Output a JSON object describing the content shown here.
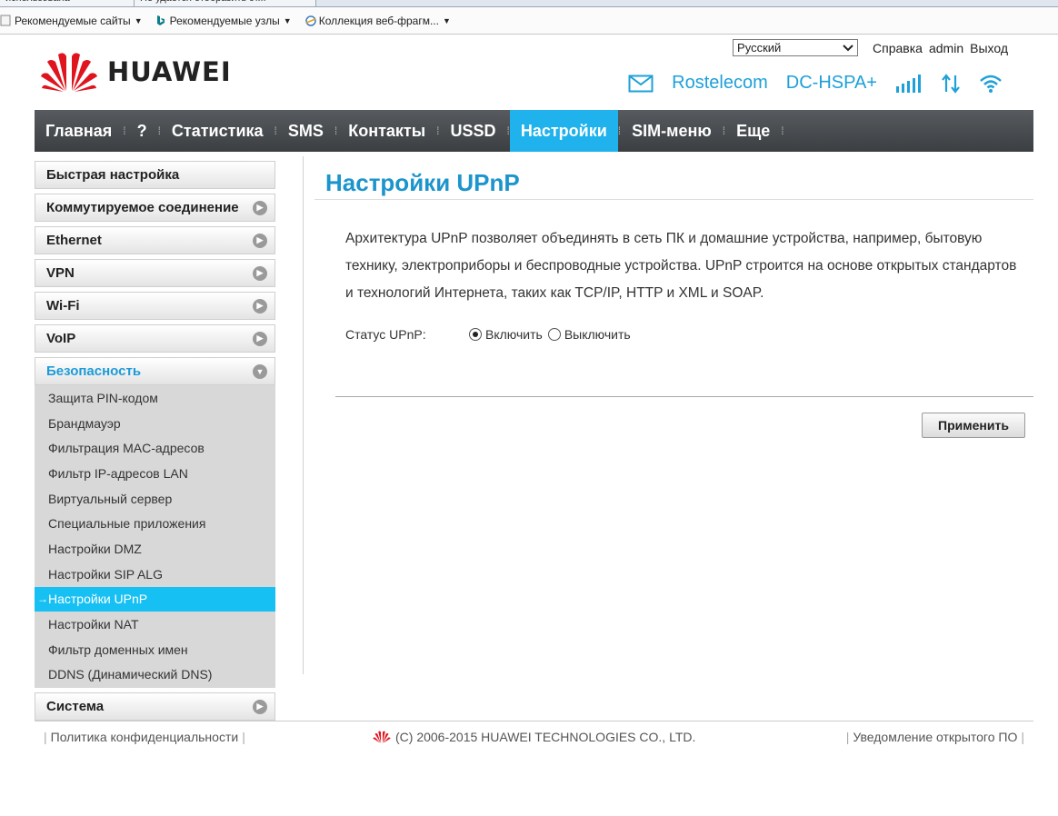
{
  "browser": {
    "tabs": [
      "использована",
      "Не удается отобразить эт..."
    ],
    "favorites": [
      {
        "label": "Рекомендуемые сайты",
        "icon": "recommended-sites-icon"
      },
      {
        "label": "Рекомендуемые узлы",
        "icon": "bing-icon"
      },
      {
        "label": "Коллекция веб-фрагм...",
        "icon": "web-slice-icon"
      }
    ]
  },
  "header": {
    "brand": "HUAWEI",
    "language": "Русский",
    "links": {
      "help": "Справка",
      "user": "admin",
      "logout": "Выход"
    },
    "operator": "Rostelecom",
    "network_type": "DC-HSPA+"
  },
  "nav": {
    "items": [
      {
        "label": "Главная",
        "active": false
      },
      {
        "label": "?",
        "active": false
      },
      {
        "label": "Статистика",
        "active": false
      },
      {
        "label": "SMS",
        "active": false
      },
      {
        "label": "Контакты",
        "active": false
      },
      {
        "label": "USSD",
        "active": false
      },
      {
        "label": "Настройки",
        "active": true
      },
      {
        "label": "SIM-меню",
        "active": false
      },
      {
        "label": "Еще",
        "active": false
      }
    ]
  },
  "sidebar": {
    "quick_setup": "Быстрая настройка",
    "dialup": "Коммутируемое соединение",
    "ethernet": "Ethernet",
    "vpn": "VPN",
    "wifi": "Wi-Fi",
    "voip": "VoIP",
    "security": "Безопасность",
    "security_items": [
      "Защита PIN-кодом",
      "Брандмауэр",
      "Фильтрация MAC-адресов",
      "Фильтр IP-адресов LAN",
      "Виртуальный сервер",
      "Специальные приложения",
      "Настройки DMZ",
      "Настройки SIP ALG",
      "Настройки UPnP",
      "Настройки NAT",
      "Фильтр доменных имен",
      "DDNS (Динамический DNS)"
    ],
    "active_item": "Настройки UPnP",
    "system": "Система"
  },
  "main": {
    "title": "Настройки UPnP",
    "description": "Архитектура UPnP позволяет объединять в сеть ПК и домашние устройства, например, бытовую технику, электроприборы и беспроводные устройства. UPnP строится на основе открытых стандартов и технологий Интернета, таких как TCP/IP, HTTP и XML и SOAP.",
    "status_label": "Статус UPnP:",
    "option_on": "Включить",
    "option_off": "Выключить",
    "selected": "Включить",
    "apply_label": "Применить"
  },
  "footer": {
    "privacy": "Политика конфиденциальности",
    "copyright": "(C) 2006-2015 HUAWEI TECHNOLOGIES CO., LTD.",
    "opensource": "Уведомление открытого ПО"
  },
  "colors": {
    "accent": "#1fb2ec",
    "title_blue": "#1c94cc",
    "nav_dark": "#484c50",
    "brand_red": "#e0141e"
  }
}
